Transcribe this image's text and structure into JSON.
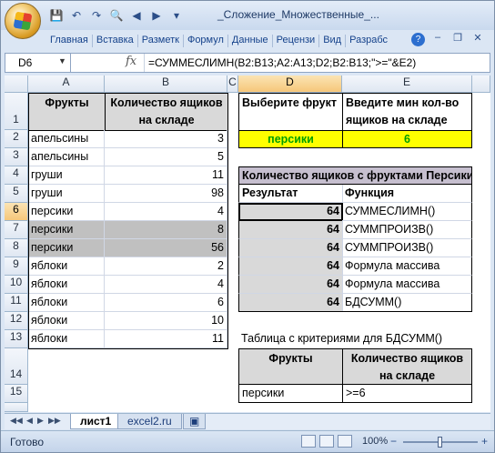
{
  "window": {
    "title": "_Сложение_Множественные_...",
    "qat_icons": [
      "save-icon",
      "undo-icon",
      "redo-icon",
      "print-preview-icon",
      "back-icon",
      "forward-icon",
      "customize-qat-icon"
    ]
  },
  "ribbon": {
    "tabs": [
      "Главная",
      "Вставка",
      "Разметк",
      "Формул",
      "Данные",
      "Рецензи",
      "Вид",
      "Разрабс"
    ],
    "help": "?"
  },
  "formula_bar": {
    "name_box": "D6",
    "fx": "fx",
    "formula": "=СУММЕСЛИМН(B2:B13;A2:A13;D2;B2:B13;\">=\"&E2)"
  },
  "columns": [
    "A",
    "B",
    "C",
    "D",
    "E"
  ],
  "rows": [
    "1",
    "2",
    "3",
    "4",
    "5",
    "6",
    "7",
    "8",
    "9",
    "10",
    "11",
    "12",
    "13",
    "14",
    "15"
  ],
  "table_main": {
    "header_fruit": "Фрукты",
    "header_qty": "Количество ящиков на складе",
    "data": [
      [
        "апельсины",
        "3"
      ],
      [
        "апельсины",
        "5"
      ],
      [
        "груши",
        "11"
      ],
      [
        "груши",
        "98"
      ],
      [
        "персики",
        "4"
      ],
      [
        "персики",
        "8"
      ],
      [
        "персики",
        "56"
      ],
      [
        "яблоки",
        "2"
      ],
      [
        "яблоки",
        "4"
      ],
      [
        "яблоки",
        "6"
      ],
      [
        "яблоки",
        "10"
      ],
      [
        "яблоки",
        "11"
      ]
    ]
  },
  "criteria": {
    "select_label": "Выберите фрукт",
    "min_label": "Введите мин кол-во ящиков на складе",
    "fruit_value": "персики",
    "min_value": "6"
  },
  "results": {
    "title": "Количество ящиков с фруктами Персики",
    "col_result": "Результат",
    "col_function": "Функция",
    "rows": [
      [
        "64",
        "СУММЕСЛИМН()"
      ],
      [
        "64",
        "СУММПРОИЗВ()"
      ],
      [
        "64",
        "СУММПРОИЗВ()"
      ],
      [
        "64",
        "Формула массива"
      ],
      [
        "64",
        "Формула массива"
      ],
      [
        "64",
        "БДСУММ()"
      ]
    ]
  },
  "dsum_table": {
    "caption": "Таблица с критериями для БДСУММ()",
    "header_fruit": "Фрукты",
    "header_qty": "Количество ящиков на складе",
    "fruit": "персики",
    "qty": ">=6"
  },
  "sheet_tabs": [
    "лист1",
    "excel2.ru"
  ],
  "status": {
    "ready": "Готово",
    "zoom": "100%"
  }
}
